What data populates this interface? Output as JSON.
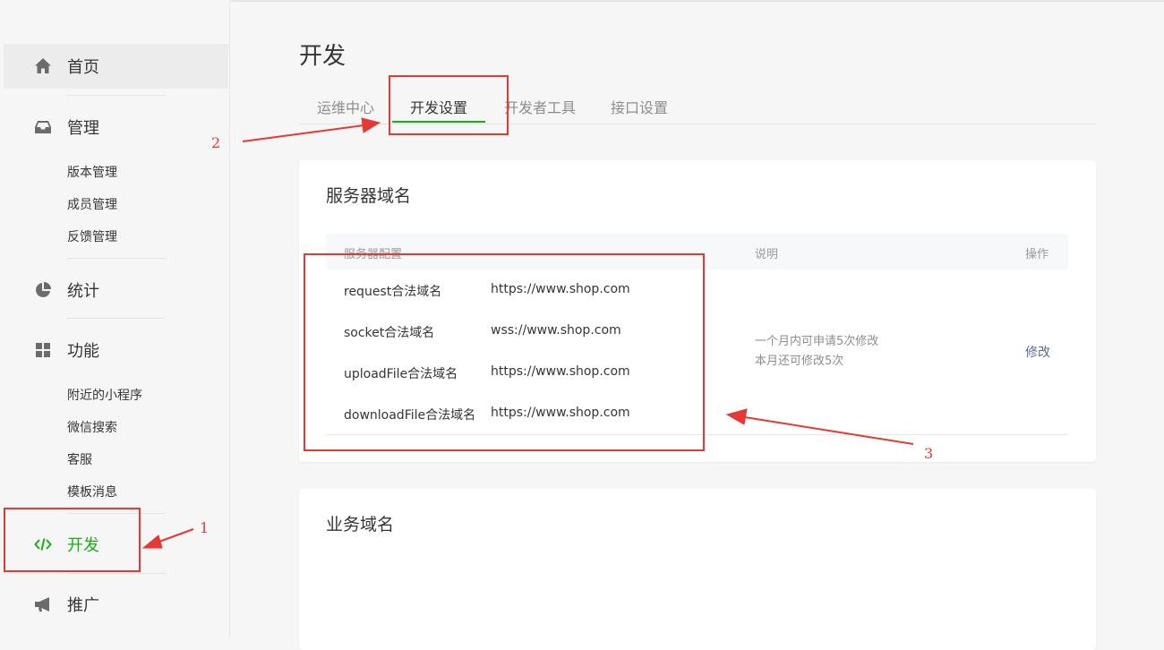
{
  "sidebar": {
    "items": [
      {
        "label": "首页",
        "icon": "home-icon"
      },
      {
        "label": "管理",
        "icon": "inbox-icon"
      },
      {
        "label": "统计",
        "icon": "pie-chart-icon"
      },
      {
        "label": "功能",
        "icon": "grid-icon"
      },
      {
        "label": "开发",
        "icon": "code-icon"
      },
      {
        "label": "推广",
        "icon": "megaphone-icon"
      }
    ],
    "manage_subitems": [
      "版本管理",
      "成员管理",
      "反馈管理"
    ],
    "feature_subitems": [
      "附近的小程序",
      "微信搜索",
      "客服",
      "模板消息"
    ]
  },
  "main": {
    "title": "开发",
    "tabs": [
      "运维中心",
      "开发设置",
      "开发者工具",
      "接口设置"
    ],
    "active_tab": "开发设置"
  },
  "server_domain": {
    "title": "服务器域名",
    "headers": {
      "config": "服务器配置",
      "desc": "说明",
      "action": "操作"
    },
    "rows": [
      {
        "name": "request合法域名",
        "url": "https://www.shop.com"
      },
      {
        "name": "socket合法域名",
        "url": "wss://www.shop.com"
      },
      {
        "name": "uploadFile合法域名",
        "url": "https://www.shop.com"
      },
      {
        "name": "downloadFile合法域名",
        "url": "https://www.shop.com"
      }
    ],
    "desc_line1": "一个月内可申请5次修改",
    "desc_line2": "本月还可修改5次",
    "action_label": "修改"
  },
  "business_domain": {
    "title": "业务域名"
  },
  "annotations": {
    "one": "1",
    "two": "2",
    "three": "3",
    "color": "#e53935"
  },
  "colors": {
    "accent": "#1aad19",
    "link": "#576b95"
  }
}
